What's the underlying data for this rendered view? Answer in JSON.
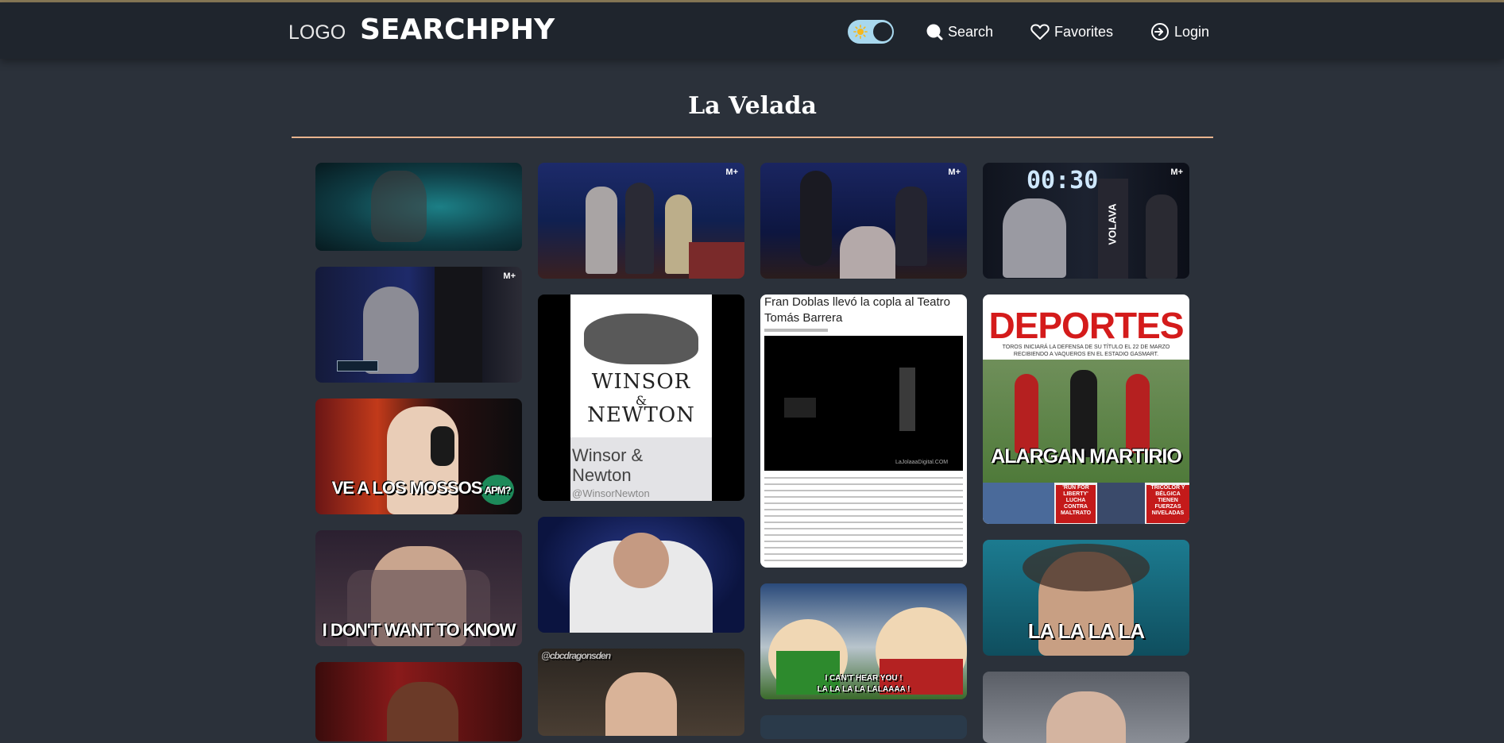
{
  "header": {
    "logo_alt": "LOGO",
    "brand": "SEARCHPHY",
    "nav": {
      "search": "Search",
      "favorites": "Favorites",
      "login": "Login"
    }
  },
  "page": {
    "title": "La Velada"
  },
  "gifs": {
    "badge": "M+",
    "timer": "00:30",
    "volava": "VOLAVA",
    "mossos": "VE A LOS MOSSOS",
    "apm": "APM?",
    "dont_know": "I DON'T WANT TO KNOW",
    "lalala": "LA LA LA LA",
    "cant_hear_1": "I CAN'T HEAR YOU !",
    "cant_hear_2": "LA LA LA LA LALAAAA !",
    "cbc": "@cbcdragonsden",
    "winsor_logo_1": "WINSOR",
    "winsor_logo_amp": "&",
    "winsor_logo_2": "NEWTON",
    "winsor_name": "Winsor & Newton",
    "winsor_handle": "@WinsorNewton",
    "article_title": "Fran Doblas llevó la copla al Teatro Tomás Barrera",
    "article_caption": "LaJolaaaDigital.COM",
    "deportes_head": "DEPORTES",
    "deportes_sub": "TOROS INICIARÁ LA DEFENSA DE SU TÍTULO EL 22 DE MARZO RECIBIENDO A VAQUEROS EN EL ESTADIO GASMART.",
    "deportes_headline": "ALARGAN MARTIRIO",
    "deportes_foot_1": "'RUN FOR LIBERTY' LUCHA CONTRA MALTRATO",
    "deportes_foot_2": "TRICOLOR Y BÉLGICA TIENEN FUERZAS NIVELADAS"
  },
  "colors": {
    "background": "#2b313a",
    "navbar": "#1f252d",
    "accent_line": "#e8b48e",
    "toggle": "#a8d8ee"
  }
}
